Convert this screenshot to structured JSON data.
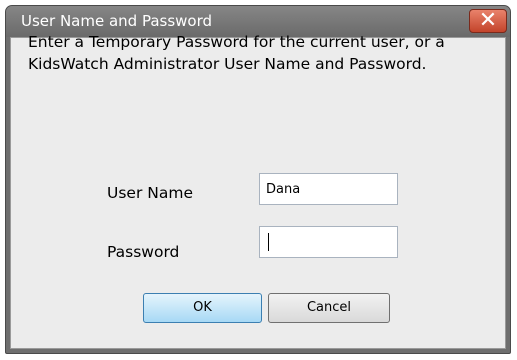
{
  "dialog": {
    "title": "User Name and Password",
    "close_glyph": "✕",
    "message": "Enter a Temporary Password for the current user, or a KidsWatch Administrator User Name and Password."
  },
  "form": {
    "username_label": "User Name",
    "username_value": "Dana",
    "password_label": "Password",
    "password_value": ""
  },
  "buttons": {
    "ok": "OK",
    "cancel": "Cancel"
  },
  "icons": {
    "close": "close-icon"
  },
  "colors": {
    "titlebar": "#6e6e6e",
    "close_button": "#c3442b",
    "ok_button": "#a7d9f5",
    "body": "#ececec"
  }
}
